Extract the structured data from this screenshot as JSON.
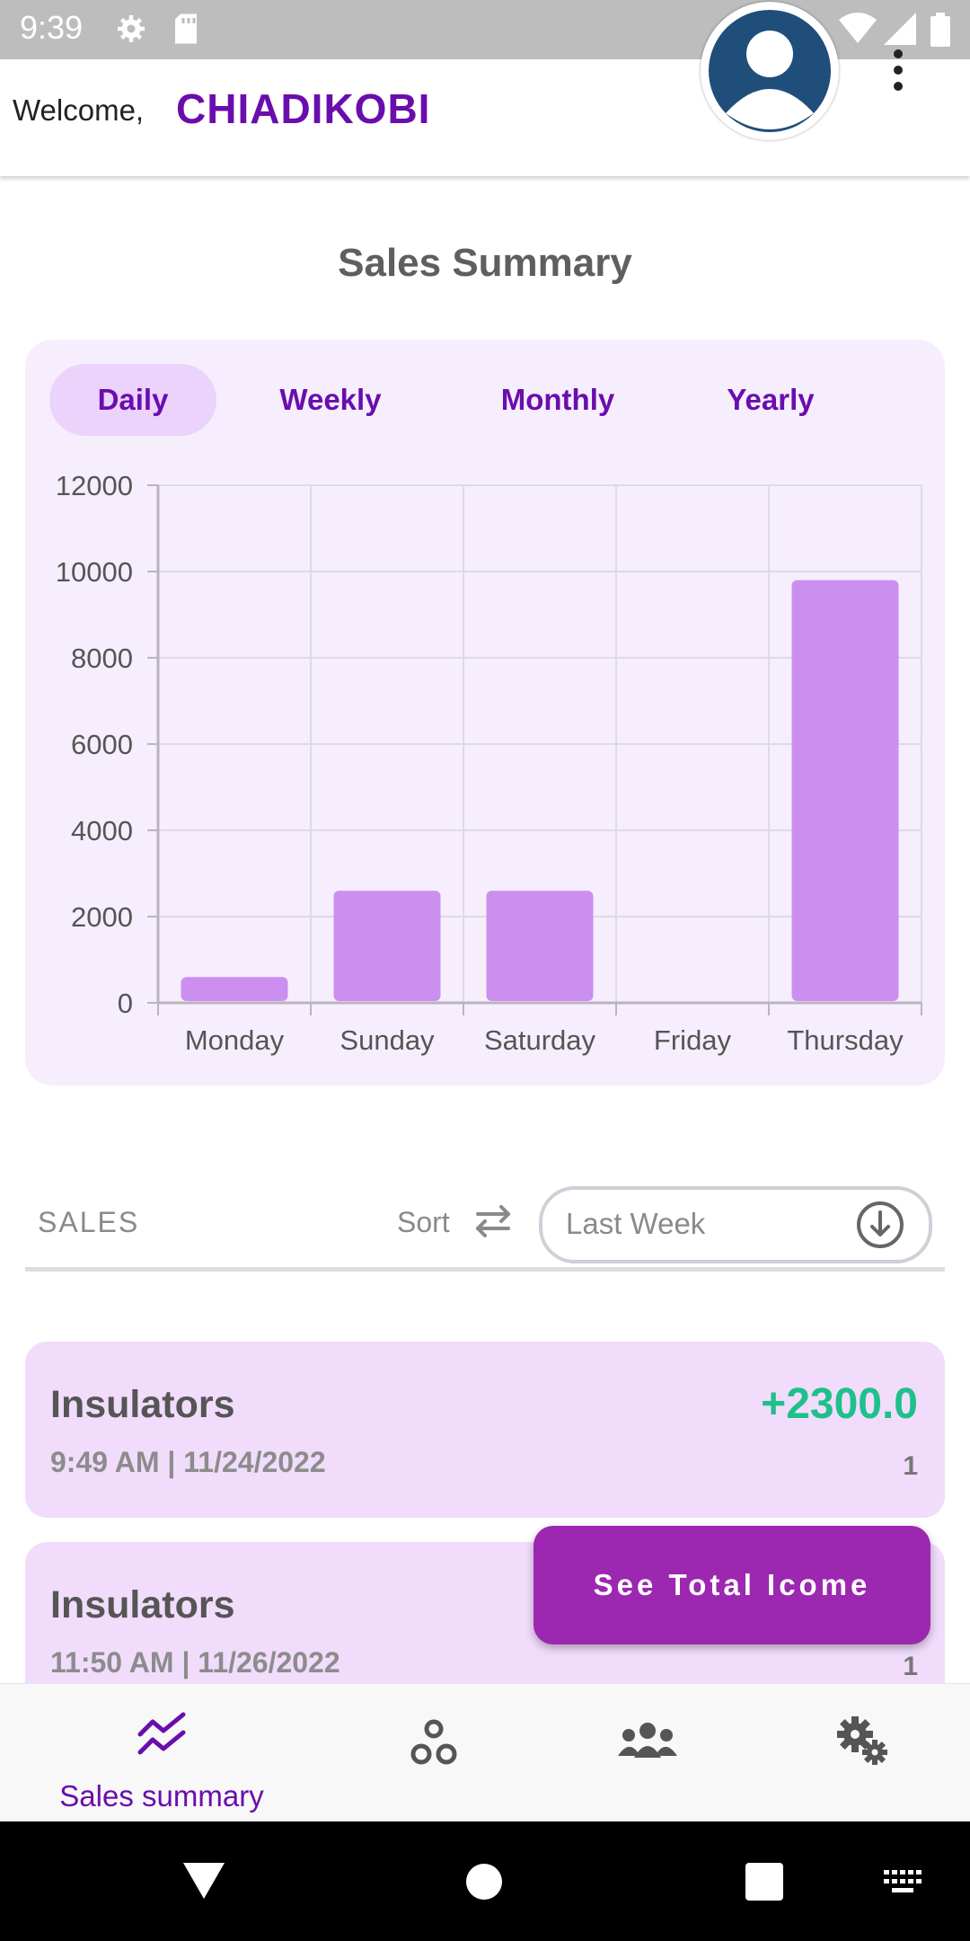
{
  "status_bar": {
    "time": "9:39"
  },
  "header": {
    "welcome": "Welcome,",
    "username": "CHIADIKOBI"
  },
  "page": {
    "title": "Sales Summary"
  },
  "tabs": [
    {
      "label": "Daily",
      "active": true
    },
    {
      "label": "Weekly",
      "active": false
    },
    {
      "label": "Monthly",
      "active": false
    },
    {
      "label": "Yearly",
      "active": false
    }
  ],
  "colors": {
    "accent": "#6a0dad",
    "bar": "#cc8ff0",
    "positive": "#1fc08a",
    "fab": "#9c27b0"
  },
  "chart_data": {
    "type": "bar",
    "categories": [
      "Monday",
      "Sunday",
      "Saturday",
      "Friday",
      "Thursday"
    ],
    "values": [
      600,
      2600,
      2600,
      0,
      9800
    ],
    "yticks": [
      0,
      2000,
      4000,
      6000,
      8000,
      10000,
      12000
    ],
    "ylim": [
      0,
      12000
    ],
    "grid": true
  },
  "sales_section": {
    "label": "SALES",
    "sort_label": "Sort",
    "period": "Last Week"
  },
  "sales": [
    {
      "name": "Insulators",
      "datetime": "9:49 AM | 11/24/2022",
      "amount": "+2300.0",
      "quantity": "1"
    },
    {
      "name": "Insulators",
      "datetime": "11:50 AM | 11/26/2022",
      "amount": "",
      "quantity": "1"
    }
  ],
  "fab": {
    "label": "See Total Icome"
  },
  "bottom_nav": [
    {
      "label": "Sales summary",
      "icon": "trend-icon",
      "active": true
    },
    {
      "label": "",
      "icon": "products-icon",
      "active": false
    },
    {
      "label": "",
      "icon": "customers-icon",
      "active": false
    },
    {
      "label": "",
      "icon": "settings-icon",
      "active": false
    }
  ]
}
